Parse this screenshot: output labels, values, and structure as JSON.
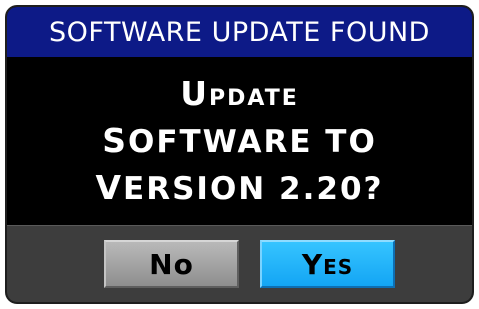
{
  "dialog": {
    "title": "SOFTWARE UPDATE FOUND",
    "message_lines": [
      "Update",
      "software to",
      "version 2.20?"
    ],
    "buttons": {
      "no_label": "No",
      "yes_label": "Yes"
    }
  },
  "colors": {
    "title_bar": "#0d1a87",
    "background": "#000000",
    "button_area": "#3d3d3d",
    "no_button": "#a0a0a0",
    "yes_button": "#1fb2ff"
  }
}
